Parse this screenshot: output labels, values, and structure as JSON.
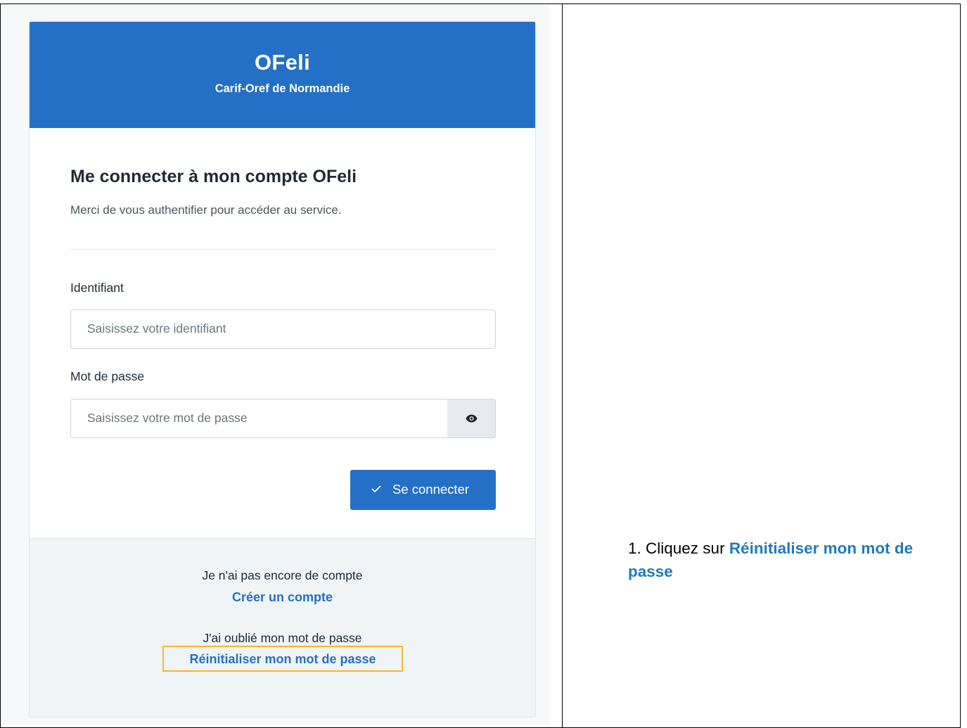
{
  "header": {
    "app_title": "OFeli",
    "app_subtitle": "Carif-Oref de Normandie"
  },
  "login": {
    "title": "Me connecter à mon compte OFeli",
    "description": "Merci de vous authentifier pour accéder au service.",
    "identifier_label": "Identifiant",
    "identifier_placeholder": "Saisissez votre identifiant",
    "identifier_value": "",
    "password_label": "Mot de passe",
    "password_placeholder": "Saisissez votre mot de passe",
    "password_value": "",
    "show_password_icon": "eye-icon",
    "connect_icon": "check-icon",
    "connect_label": "Se connecter"
  },
  "footer": {
    "no_account_text": "Je n'ai pas encore de compte",
    "create_account_link": "Créer un compte",
    "forgot_text": "J'ai oublié mon mot de passe",
    "reset_link": "Réinitialiser mon mot de passe"
  },
  "instruction": {
    "prefix": "1. Cliquez sur ",
    "highlight": "Réinitialiser mon mot de passe"
  },
  "colors": {
    "brand_blue": "#2370c6",
    "highlight_box": "#f5b62b",
    "instruction_link": "#1f7ac0"
  }
}
